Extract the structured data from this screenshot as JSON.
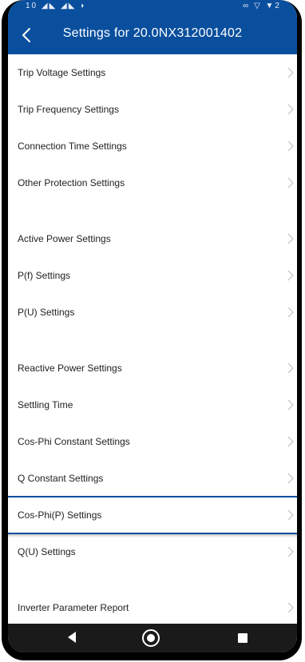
{
  "status_bar": {
    "left": "10 ◢◣ ◢◣ ◗",
    "right": "∞ ▽ ▼2"
  },
  "header": {
    "title": "Settings for 20.0NX312001402"
  },
  "groups": [
    {
      "items": [
        {
          "label": "Trip Voltage Settings"
        },
        {
          "label": "Trip Frequency Settings"
        },
        {
          "label": "Connection Time Settings"
        },
        {
          "label": "Other Protection Settings"
        }
      ]
    },
    {
      "items": [
        {
          "label": "Active Power Settings"
        },
        {
          "label": "P(f) Settings"
        },
        {
          "label": "P(U) Settings"
        }
      ]
    },
    {
      "items": [
        {
          "label": "Reactive Power Settings"
        },
        {
          "label": "Settling Time"
        },
        {
          "label": "Cos-Phi Constant Settings"
        },
        {
          "label": "Q Constant Settings"
        },
        {
          "label": "Cos-Phi(P) Settings",
          "selected": true
        },
        {
          "label": "Q(U) Settings"
        }
      ]
    },
    {
      "items": [
        {
          "label": "Inverter Parameter Report"
        }
      ]
    }
  ],
  "colors": {
    "header_bg": "#0a4f9e",
    "chevron": "#c8c8c8"
  },
  "icons": {
    "back": "chevron-left-icon",
    "row": "chevron-right-icon",
    "nav_back": "triangle-left-icon",
    "nav_home": "circle-icon",
    "nav_recent": "square-icon"
  }
}
